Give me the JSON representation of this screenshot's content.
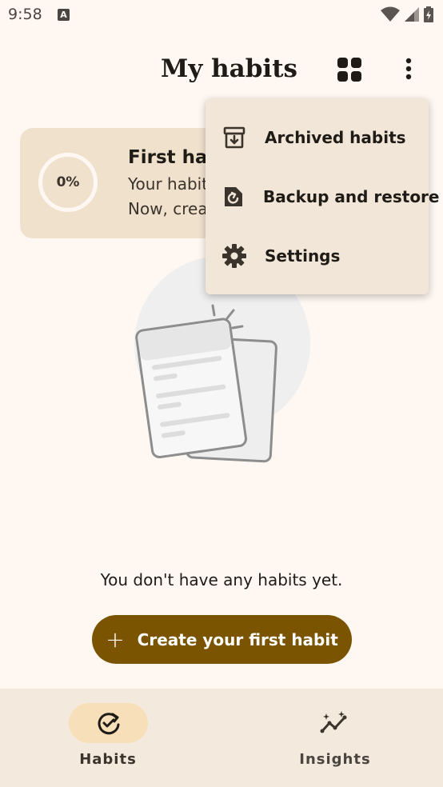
{
  "status_bar": {
    "time": "9:58",
    "notification_glyph": "A"
  },
  "header": {
    "title": "My habits",
    "grid_icon": "grid-view-icon",
    "more_icon": "more-vert-icon"
  },
  "progress_card": {
    "percent": "0%",
    "progress_value": 0,
    "title": "First hab",
    "line1": "Your habit",
    "line2": "Now, crea"
  },
  "empty_state": {
    "message": "You don't have any habits yet."
  },
  "create_button": {
    "icon": "plus-icon",
    "label": "Create your first habit"
  },
  "menu": {
    "items": [
      {
        "label": "Archived habits",
        "icon": "archive-icon"
      },
      {
        "label": "Backup and restore",
        "icon": "backup-restore-icon"
      },
      {
        "label": "Settings",
        "icon": "gear-icon"
      }
    ]
  },
  "bottom_nav": {
    "items": [
      {
        "label": "Habits",
        "icon": "habits-check-icon",
        "selected": true
      },
      {
        "label": "Insights",
        "icon": "insights-icon",
        "selected": false
      }
    ]
  },
  "colors": {
    "background": "#fff8f2",
    "primary": "#7a5400",
    "card": "#f0e1cd",
    "nav": "#f3e9dd",
    "nav_active": "#f7dfb9",
    "menu": "#f1e6d7"
  }
}
